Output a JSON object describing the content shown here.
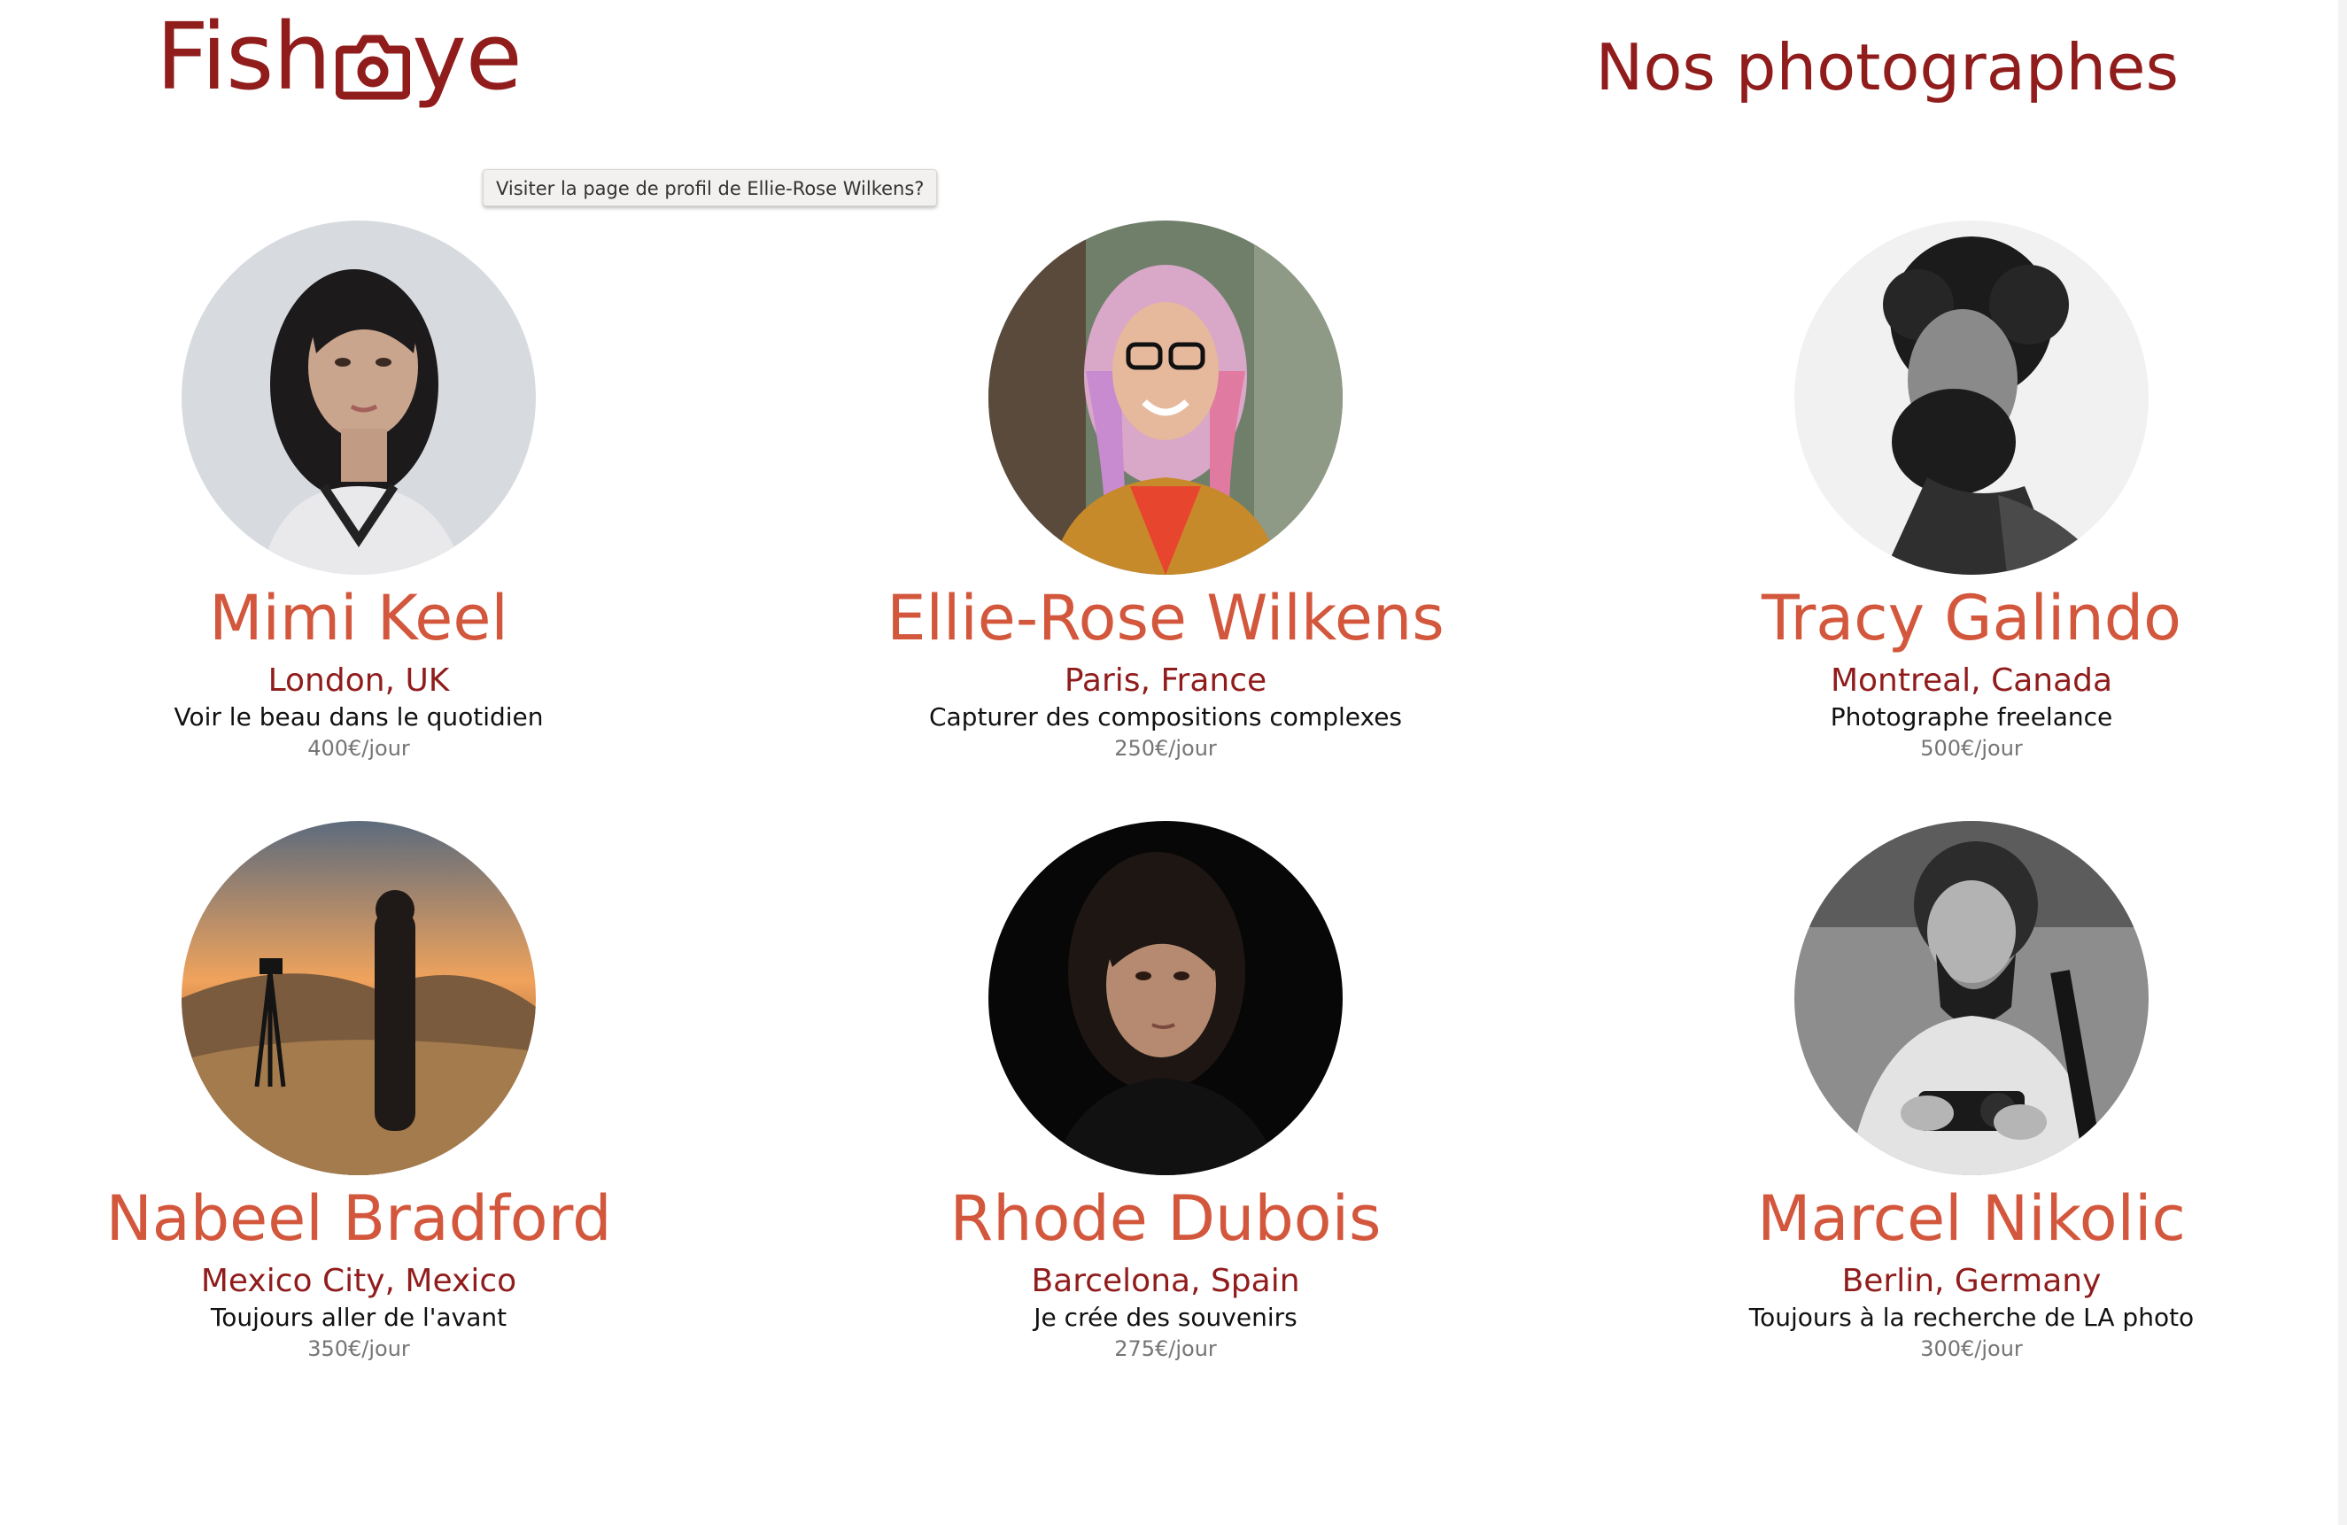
{
  "header": {
    "logo_text_before": "Fish",
    "logo_text_after": "ye",
    "title": "Nos photographes"
  },
  "tooltip": "Visiter la page de profil de Ellie-Rose Wilkens?",
  "photographers": [
    {
      "name": "Mimi Keel",
      "location": "London, UK",
      "tagline": "Voir le beau dans le quotidien",
      "price": "400€/jour"
    },
    {
      "name": "Ellie-Rose Wilkens",
      "location": "Paris, France",
      "tagline": "Capturer des compositions complexes",
      "price": "250€/jour"
    },
    {
      "name": "Tracy Galindo",
      "location": "Montreal, Canada",
      "tagline": "Photographe freelance",
      "price": "500€/jour"
    },
    {
      "name": "Nabeel Bradford",
      "location": "Mexico City, Mexico",
      "tagline": "Toujours aller de l'avant",
      "price": "350€/jour"
    },
    {
      "name": "Rhode Dubois",
      "location": "Barcelona, Spain",
      "tagline": "Je crée des souvenirs",
      "price": "275€/jour"
    },
    {
      "name": "Marcel Nikolic",
      "location": "Berlin, Germany",
      "tagline": "Toujours à la recherche de LA photo",
      "price": "300€/jour"
    }
  ],
  "colors": {
    "primary": "#901c1c",
    "secondary": "#d3573c",
    "text": "#111111",
    "muted": "#757575"
  },
  "icons": {
    "logo_camera": "camera-icon"
  }
}
